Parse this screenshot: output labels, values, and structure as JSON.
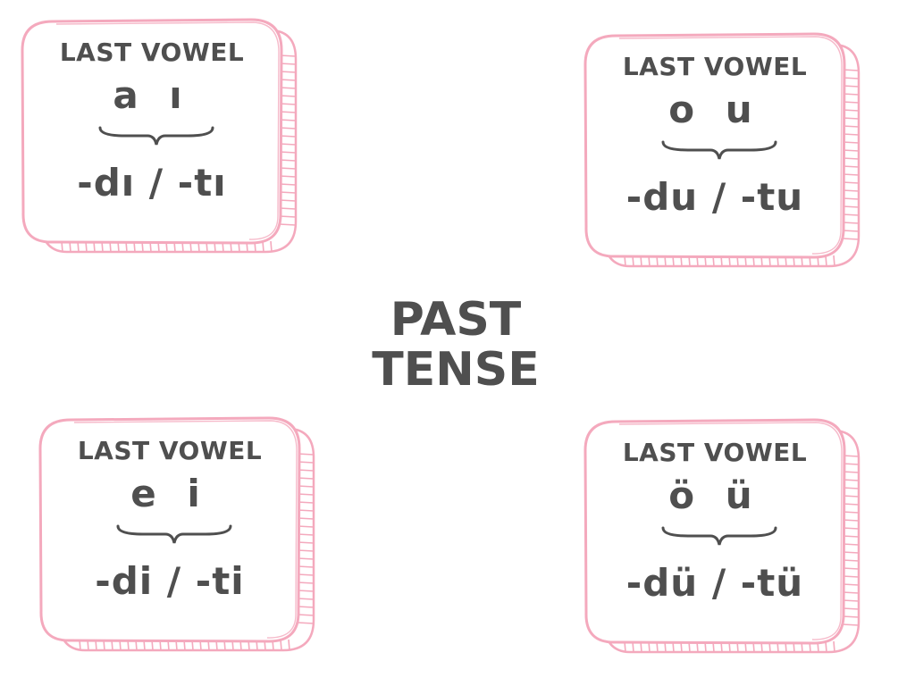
{
  "title": {
    "line1": "PAST",
    "line2": "TENSE"
  },
  "cards": [
    {
      "heading": "LAST VOWEL",
      "vowels": "a ı",
      "suffix": "-dı / -tı"
    },
    {
      "heading": "LAST VOWEL",
      "vowels": "o u",
      "suffix": "-du / -tu"
    },
    {
      "heading": "LAST VOWEL",
      "vowels": "e i",
      "suffix": "-di / -ti"
    },
    {
      "heading": "LAST VOWEL",
      "vowels": "ö ü",
      "suffix": "-dü / -tü"
    }
  ],
  "colors": {
    "card_border": "#f4a9bd",
    "text": "#4f4f4f",
    "background": "#ffffff"
  }
}
